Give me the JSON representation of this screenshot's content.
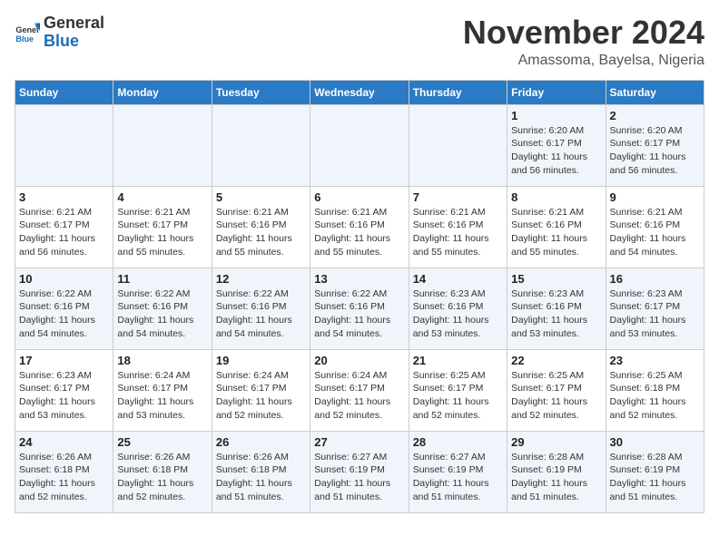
{
  "header": {
    "logo_general": "General",
    "logo_blue": "Blue",
    "month_title": "November 2024",
    "location": "Amassoma, Bayelsa, Nigeria"
  },
  "calendar": {
    "days_of_week": [
      "Sunday",
      "Monday",
      "Tuesday",
      "Wednesday",
      "Thursday",
      "Friday",
      "Saturday"
    ],
    "weeks": [
      [
        {
          "day": "",
          "info": ""
        },
        {
          "day": "",
          "info": ""
        },
        {
          "day": "",
          "info": ""
        },
        {
          "day": "",
          "info": ""
        },
        {
          "day": "",
          "info": ""
        },
        {
          "day": "1",
          "info": "Sunrise: 6:20 AM\nSunset: 6:17 PM\nDaylight: 11 hours and 56 minutes."
        },
        {
          "day": "2",
          "info": "Sunrise: 6:20 AM\nSunset: 6:17 PM\nDaylight: 11 hours and 56 minutes."
        }
      ],
      [
        {
          "day": "3",
          "info": "Sunrise: 6:21 AM\nSunset: 6:17 PM\nDaylight: 11 hours and 56 minutes."
        },
        {
          "day": "4",
          "info": "Sunrise: 6:21 AM\nSunset: 6:17 PM\nDaylight: 11 hours and 55 minutes."
        },
        {
          "day": "5",
          "info": "Sunrise: 6:21 AM\nSunset: 6:16 PM\nDaylight: 11 hours and 55 minutes."
        },
        {
          "day": "6",
          "info": "Sunrise: 6:21 AM\nSunset: 6:16 PM\nDaylight: 11 hours and 55 minutes."
        },
        {
          "day": "7",
          "info": "Sunrise: 6:21 AM\nSunset: 6:16 PM\nDaylight: 11 hours and 55 minutes."
        },
        {
          "day": "8",
          "info": "Sunrise: 6:21 AM\nSunset: 6:16 PM\nDaylight: 11 hours and 55 minutes."
        },
        {
          "day": "9",
          "info": "Sunrise: 6:21 AM\nSunset: 6:16 PM\nDaylight: 11 hours and 54 minutes."
        }
      ],
      [
        {
          "day": "10",
          "info": "Sunrise: 6:22 AM\nSunset: 6:16 PM\nDaylight: 11 hours and 54 minutes."
        },
        {
          "day": "11",
          "info": "Sunrise: 6:22 AM\nSunset: 6:16 PM\nDaylight: 11 hours and 54 minutes."
        },
        {
          "day": "12",
          "info": "Sunrise: 6:22 AM\nSunset: 6:16 PM\nDaylight: 11 hours and 54 minutes."
        },
        {
          "day": "13",
          "info": "Sunrise: 6:22 AM\nSunset: 6:16 PM\nDaylight: 11 hours and 54 minutes."
        },
        {
          "day": "14",
          "info": "Sunrise: 6:23 AM\nSunset: 6:16 PM\nDaylight: 11 hours and 53 minutes."
        },
        {
          "day": "15",
          "info": "Sunrise: 6:23 AM\nSunset: 6:16 PM\nDaylight: 11 hours and 53 minutes."
        },
        {
          "day": "16",
          "info": "Sunrise: 6:23 AM\nSunset: 6:17 PM\nDaylight: 11 hours and 53 minutes."
        }
      ],
      [
        {
          "day": "17",
          "info": "Sunrise: 6:23 AM\nSunset: 6:17 PM\nDaylight: 11 hours and 53 minutes."
        },
        {
          "day": "18",
          "info": "Sunrise: 6:24 AM\nSunset: 6:17 PM\nDaylight: 11 hours and 53 minutes."
        },
        {
          "day": "19",
          "info": "Sunrise: 6:24 AM\nSunset: 6:17 PM\nDaylight: 11 hours and 52 minutes."
        },
        {
          "day": "20",
          "info": "Sunrise: 6:24 AM\nSunset: 6:17 PM\nDaylight: 11 hours and 52 minutes."
        },
        {
          "day": "21",
          "info": "Sunrise: 6:25 AM\nSunset: 6:17 PM\nDaylight: 11 hours and 52 minutes."
        },
        {
          "day": "22",
          "info": "Sunrise: 6:25 AM\nSunset: 6:17 PM\nDaylight: 11 hours and 52 minutes."
        },
        {
          "day": "23",
          "info": "Sunrise: 6:25 AM\nSunset: 6:18 PM\nDaylight: 11 hours and 52 minutes."
        }
      ],
      [
        {
          "day": "24",
          "info": "Sunrise: 6:26 AM\nSunset: 6:18 PM\nDaylight: 11 hours and 52 minutes."
        },
        {
          "day": "25",
          "info": "Sunrise: 6:26 AM\nSunset: 6:18 PM\nDaylight: 11 hours and 52 minutes."
        },
        {
          "day": "26",
          "info": "Sunrise: 6:26 AM\nSunset: 6:18 PM\nDaylight: 11 hours and 51 minutes."
        },
        {
          "day": "27",
          "info": "Sunrise: 6:27 AM\nSunset: 6:19 PM\nDaylight: 11 hours and 51 minutes."
        },
        {
          "day": "28",
          "info": "Sunrise: 6:27 AM\nSunset: 6:19 PM\nDaylight: 11 hours and 51 minutes."
        },
        {
          "day": "29",
          "info": "Sunrise: 6:28 AM\nSunset: 6:19 PM\nDaylight: 11 hours and 51 minutes."
        },
        {
          "day": "30",
          "info": "Sunrise: 6:28 AM\nSunset: 6:19 PM\nDaylight: 11 hours and 51 minutes."
        }
      ]
    ]
  }
}
